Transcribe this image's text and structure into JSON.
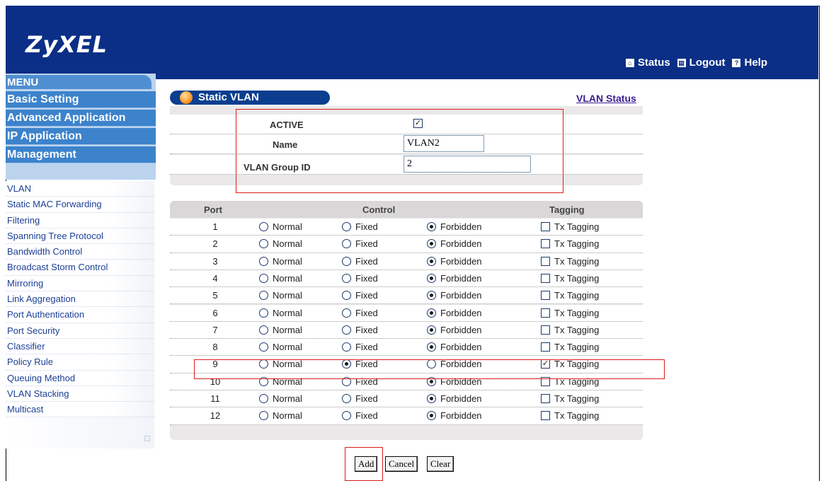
{
  "header": {
    "logo": "ZyXEL",
    "links": [
      {
        "icon": "home-icon",
        "label": "Status"
      },
      {
        "icon": "logout-icon",
        "label": "Logout"
      },
      {
        "icon": "help-icon",
        "label": "Help"
      }
    ]
  },
  "menu": {
    "title": "MENU",
    "main_items": [
      "Basic Setting",
      "Advanced Application",
      "IP Application",
      "Management"
    ],
    "sub_items": [
      "VLAN",
      "Static MAC Forwarding",
      "Filtering",
      "Spanning Tree Protocol",
      "Bandwidth Control",
      "Broadcast Storm Control",
      "Mirroring",
      "Link Aggregation",
      "Port Authentication",
      "Port Security",
      "Classifier",
      "Policy Rule",
      "Queuing Method",
      "VLAN Stacking",
      "Multicast"
    ]
  },
  "page": {
    "title": "Static VLAN",
    "status_link": "VLAN Status"
  },
  "form": {
    "active_label": "ACTIVE",
    "active_checked": true,
    "name_label": "Name",
    "name_value": "VLAN2",
    "group_label": "VLAN Group ID",
    "group_value": "2"
  },
  "table": {
    "headers": [
      "Port",
      "Control",
      "Tagging"
    ],
    "option_labels": [
      "Normal",
      "Fixed",
      "Forbidden"
    ],
    "tag_label": "Tx Tagging",
    "rows": [
      {
        "port": "1",
        "control": "Forbidden",
        "tagged": false
      },
      {
        "port": "2",
        "control": "Forbidden",
        "tagged": false
      },
      {
        "port": "3",
        "control": "Forbidden",
        "tagged": false
      },
      {
        "port": "4",
        "control": "Forbidden",
        "tagged": false
      },
      {
        "port": "5",
        "control": "Forbidden",
        "tagged": false
      },
      {
        "port": "6",
        "control": "Forbidden",
        "tagged": false
      },
      {
        "port": "7",
        "control": "Forbidden",
        "tagged": false
      },
      {
        "port": "8",
        "control": "Forbidden",
        "tagged": false
      },
      {
        "port": "9",
        "control": "Fixed",
        "tagged": true
      },
      {
        "port": "10",
        "control": "Forbidden",
        "tagged": false
      },
      {
        "port": "11",
        "control": "Forbidden",
        "tagged": false
      },
      {
        "port": "12",
        "control": "Forbidden",
        "tagged": false
      }
    ]
  },
  "buttons": {
    "add": "Add",
    "cancel": "Cancel",
    "clear": "Clear"
  },
  "colors": {
    "header_bg": "#0b2f86",
    "menu_main": "#3c83cc",
    "highlight": "#d91c1c"
  }
}
